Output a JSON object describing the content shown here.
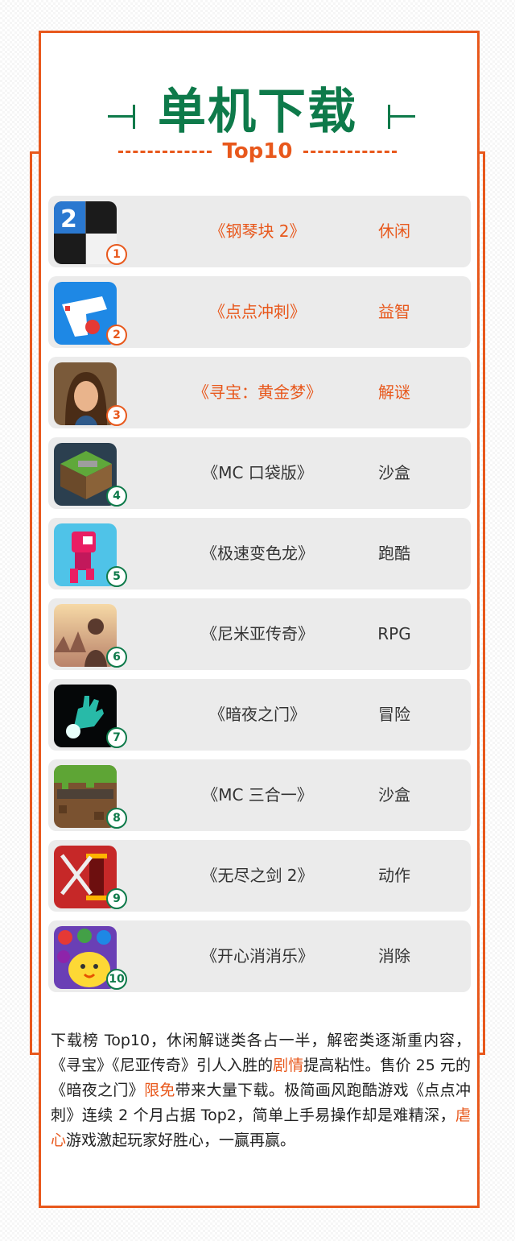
{
  "header": {
    "title": "单机下载",
    "subtitle": "Top10"
  },
  "colors": {
    "accent_orange": "#e8581c",
    "accent_green": "#0e7a4a",
    "row_background": "#ebebeb"
  },
  "games": [
    {
      "rank": "1",
      "name": "《钢琴块 2》",
      "genre": "休闲",
      "icon": "piano-tiles-icon",
      "highlight": true
    },
    {
      "rank": "2",
      "name": "《点点冲刺》",
      "genre": "益智",
      "icon": "dot-dash-icon",
      "highlight": true
    },
    {
      "rank": "3",
      "name": "《寻宝：黄金梦》",
      "genre": "解谜",
      "icon": "treasure-hunt-icon",
      "highlight": true
    },
    {
      "rank": "4",
      "name": "《MC 口袋版》",
      "genre": "沙盒",
      "icon": "mc-pocket-icon",
      "highlight": false
    },
    {
      "rank": "5",
      "name": "《极速变色龙》",
      "genre": "跑酷",
      "icon": "chameleon-run-icon",
      "highlight": false
    },
    {
      "rank": "6",
      "name": "《尼米亚传奇》",
      "genre": "RPG",
      "icon": "nimian-legends-icon",
      "highlight": false
    },
    {
      "rank": "7",
      "name": "《暗夜之门》",
      "genre": "冒险",
      "icon": "dark-gate-icon",
      "highlight": false
    },
    {
      "rank": "8",
      "name": "《MC 三合一》",
      "genre": "沙盒",
      "icon": "minecraft-icon",
      "highlight": false
    },
    {
      "rank": "9",
      "name": "《无尽之剑 2》",
      "genre": "动作",
      "icon": "infinity-blade-icon",
      "highlight": false
    },
    {
      "rank": "10",
      "name": "《开心消消乐》",
      "genre": "消除",
      "icon": "happy-match-icon",
      "highlight": false
    }
  ],
  "description": {
    "part1": "下载榜 Top10，休闲解谜类各占一半，解密类逐渐重内容，《寻宝》《尼亚传奇》引人入胜的",
    "em1": "剧情",
    "part2": "提高粘性。售价 25 元的《暗夜之门》",
    "em2": "限免",
    "part3": "带来大量下载。极简画风跑酷游戏《点点冲刺》连续 2 个月占据 Top2，简单上手易操作却是难精深，",
    "em3": "虐心",
    "part4": "游戏激起玩家好胜心，一赢再赢。"
  }
}
